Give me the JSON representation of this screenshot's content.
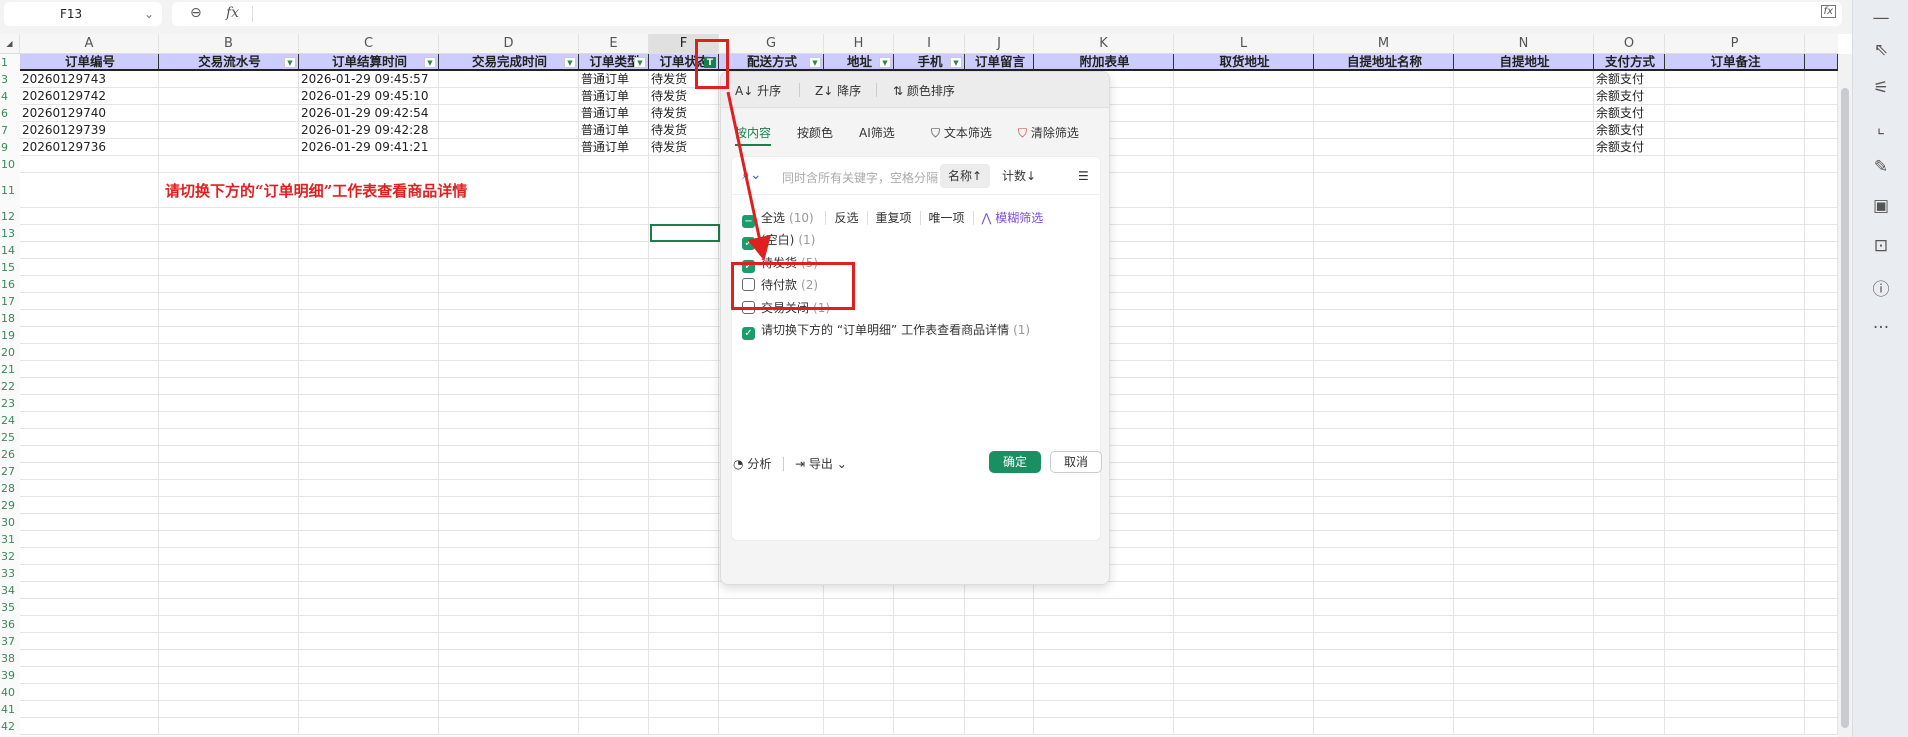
{
  "formula_bar": {
    "name_box": "F13",
    "zoom_icon": "zoom-out-icon",
    "fx_label": "fx",
    "formula": ""
  },
  "columns": [
    "A",
    "B",
    "C",
    "D",
    "E",
    "F",
    "G",
    "H",
    "I",
    "J",
    "K",
    "L",
    "M",
    "N",
    "O",
    "P"
  ],
  "selected_column": "F",
  "header_row": {
    "row": "1",
    "cells": [
      "订单编号",
      "交易流水号",
      "订单结算时间",
      "交易完成时间",
      "订单类型",
      "订单状态",
      "配送方式",
      "地址",
      "手机",
      "订单留言",
      "附加表单",
      "取货地址",
      "自提地址名称",
      "自提地址",
      "支付方式",
      "订单备注"
    ]
  },
  "filter_dropdown_columns": [
    "B",
    "C",
    "D",
    "E",
    "F",
    "G",
    "H",
    "I"
  ],
  "active_filter_column": "F",
  "data_rows": [
    {
      "row": "3",
      "cells": {
        "A": "20260129743",
        "C": "2026-01-29 09:45:57",
        "E": "普通订单",
        "F": "待发货",
        "O": "余额支付"
      }
    },
    {
      "row": "4",
      "cells": {
        "A": "20260129742",
        "C": "2026-01-29 09:45:10",
        "E": "普通订单",
        "F": "待发货",
        "O": "余额支付"
      }
    },
    {
      "row": "6",
      "cells": {
        "A": "20260129740",
        "C": "2026-01-29 09:42:54",
        "E": "普通订单",
        "F": "待发货",
        "O": "余额支付"
      }
    },
    {
      "row": "7",
      "cells": {
        "A": "20260129739",
        "C": "2026-01-29 09:42:28",
        "E": "普通订单",
        "F": "待发货",
        "O": "余额支付"
      }
    },
    {
      "row": "9",
      "cells": {
        "A": "20260129736",
        "C": "2026-01-29 09:41:21",
        "E": "普通订单",
        "F": "待发货",
        "O": "余额支付"
      }
    }
  ],
  "note_row": "11",
  "note_text": "请切换下方的“订单明细”工作表查看商品详情",
  "empty_rows_from": 12,
  "empty_rows_to": 42,
  "filter_panel": {
    "sort_asc": "升序",
    "sort_desc": "降序",
    "sort_color": "颜色排序",
    "tabs": [
      "按内容",
      "按颜色",
      "AI筛选"
    ],
    "active_tab": "按内容",
    "text_filter": "文本筛选",
    "clear_filter": "清除筛选",
    "search_placeholder": "同时含所有关键字，空格分隔",
    "sort_by_name": "名称↑",
    "sort_by_count": "计数↓",
    "select_all": {
      "label": "全选",
      "count": "(10)",
      "state": "partial"
    },
    "actions": [
      "反选",
      "重复项",
      "唯一项"
    ],
    "fuzzy": "模糊筛选",
    "items": [
      {
        "label": "(空白)",
        "count": "(1)",
        "checked": true
      },
      {
        "label": "待发货",
        "count": "(5)",
        "checked": true
      },
      {
        "label": "待付款",
        "count": "(2)",
        "checked": false
      },
      {
        "label": "交易关闭",
        "count": "(1)",
        "checked": false
      },
      {
        "label": "请切换下方的 “订单明细” 工作表查看商品详情",
        "count": "(1)",
        "checked": true
      }
    ],
    "analyze": "分析",
    "export": "导出",
    "confirm": "确定",
    "cancel": "取消"
  },
  "colors": {
    "header_fill": "#ccccff",
    "accent": "#1a7f4b",
    "annotation": "#e01f1f"
  },
  "sidebar_icons": [
    "minimize-icon",
    "pointer-icon",
    "sliders-icon",
    "crop-icon",
    "tools-icon",
    "image-edit-icon",
    "book-search-icon",
    "help-icon",
    "more-icon"
  ]
}
